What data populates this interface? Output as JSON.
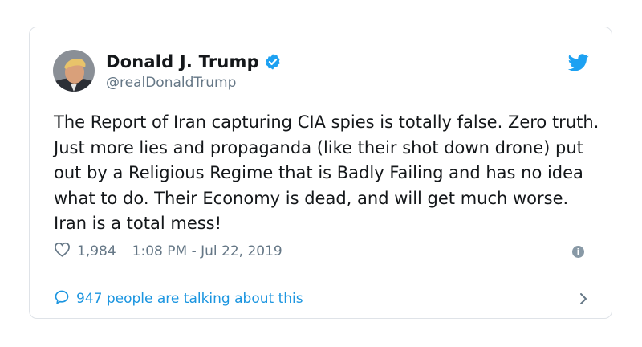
{
  "user": {
    "name": "Donald J. Trump",
    "handle": "@realDonaldTrump",
    "verified": true
  },
  "tweet": {
    "text": "The Report of Iran capturing CIA spies is totally false. Zero truth. Just more lies and propaganda (like their shot down drone) put out by a Religious Regime that is Badly Failing and has no idea what to do. Their Economy is dead, and will get much worse. Iran is a total mess!",
    "likes": "1,984",
    "timestamp": "1:08 PM - Jul 22, 2019"
  },
  "footer": {
    "talking_label": "947 people are talking about this"
  },
  "icons": {
    "brand": "twitter-bird-icon",
    "verified": "verified-badge-icon",
    "like": "heart-icon",
    "info": "info-icon",
    "reply": "speech-bubble-icon",
    "chevron": "chevron-right-icon"
  },
  "colors": {
    "twitter_blue": "#1da1f2",
    "link_blue": "#1b95e0",
    "secondary_text": "#657786",
    "primary_text": "#14171a",
    "border": "#dfe3e8"
  }
}
